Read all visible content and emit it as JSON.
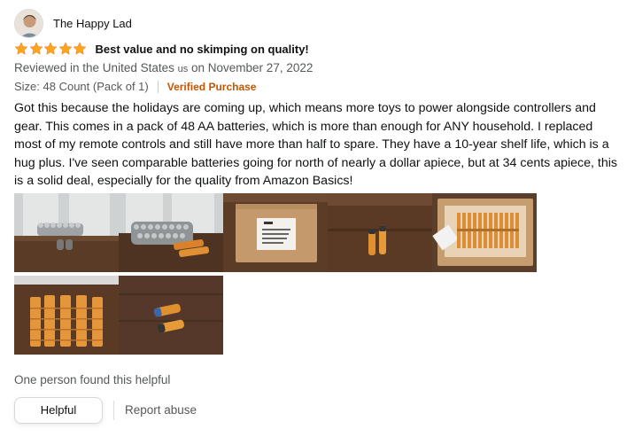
{
  "reviewer": {
    "name": "The Happy Lad",
    "avatar_icon": "user-avatar"
  },
  "review": {
    "rating": 5,
    "rating_max": 5,
    "title": "Best value and no skimping on quality!",
    "date_prefix": "Reviewed in the United States",
    "country_code": "us",
    "date_suffix": "on November 27, 2022",
    "variant": "Size: 48 Count (Pack of 1)",
    "verified": "Verified Purchase",
    "body": "Got this because the holidays are coming up, which means more toys to power alongside controllers and gear. This comes in a pack of 48 AA batteries, which is more than enough for ANY household. I replaced most of my remote controls and still have more than half to spare. They have a 10-year shelf life, which is a hug plus. I've seen comparable batteries going for north of nearly a dollar apiece, but at 34 cents apiece, this is a solid deal, especially for the quality from Amazon Basics!"
  },
  "images": [
    "batteries-row-standing",
    "batteries-pile-with-two-loose",
    "amazon-box-closed",
    "two-batteries-on-table",
    "box-open-batteries",
    "batteries-grid-on-table",
    "two-batteries-close-up"
  ],
  "actions": {
    "helpful_count": "One person found this helpful",
    "helpful_label": "Helpful",
    "report_label": "Report abuse"
  },
  "colors": {
    "star": "#ffa41c",
    "verified": "#c45500",
    "secondary_text": "#565959"
  }
}
